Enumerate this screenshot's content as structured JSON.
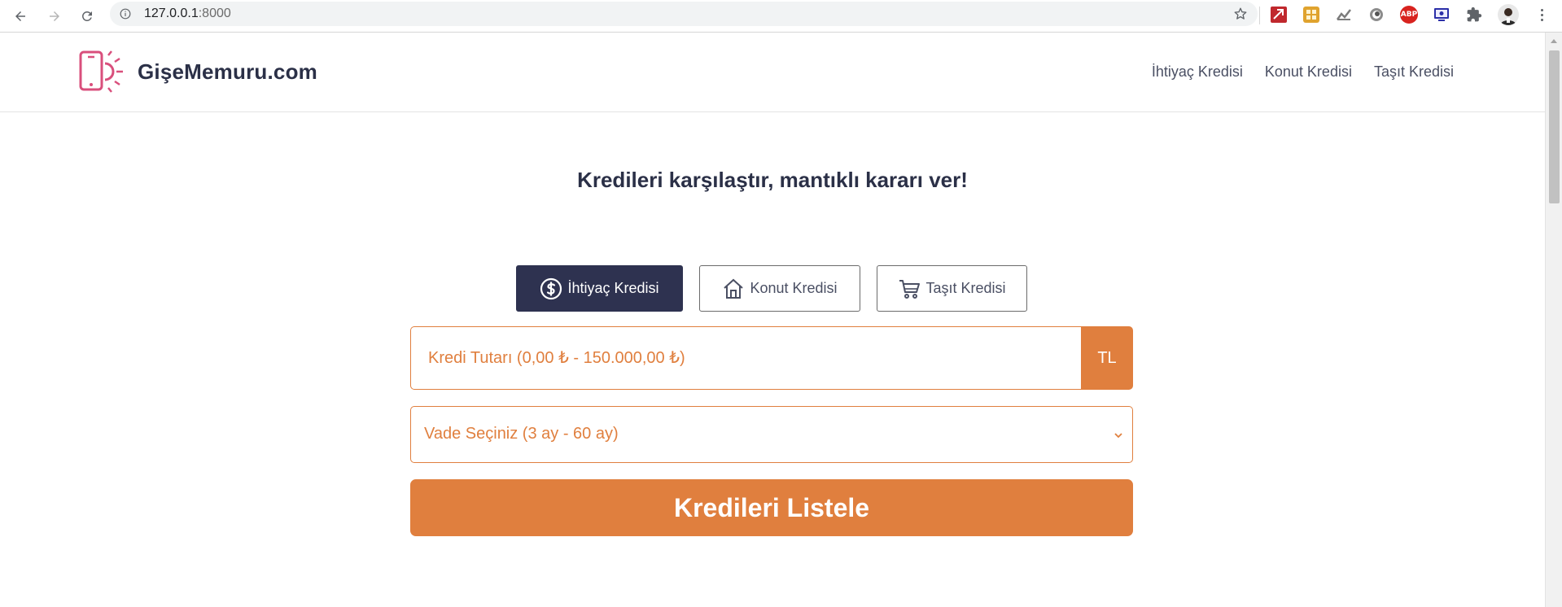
{
  "browser": {
    "url_host": "127.0.0.1",
    "url_port": ":8000",
    "icons": [
      "back-icon",
      "forward-icon",
      "reload-icon",
      "site-info-icon",
      "bookmark-star-icon",
      "extensions-puzzle-icon",
      "profile-avatar",
      "menu-dots-icon"
    ],
    "extensions": [
      {
        "name": "pdf-extension-icon",
        "label": "",
        "color": "#c0282d"
      },
      {
        "name": "grid-extension-icon",
        "label": "",
        "color": "#e0a32e"
      },
      {
        "name": "chart-extension-icon",
        "label": "",
        "color": "#7c7c7c"
      },
      {
        "name": "circle-extension-icon",
        "label": "",
        "color": "#555555"
      },
      {
        "name": "adblock-extension-icon",
        "label": "ABP",
        "color": "#d8231f"
      },
      {
        "name": "screen-extension-icon",
        "label": "",
        "color": "#2b2fa8"
      }
    ]
  },
  "header": {
    "brand": "GişeMemuru.com",
    "logo_icon": "phone-sun-icon",
    "logo_color": "#d94f7c",
    "nav": [
      {
        "label": "İhtiyaç Kredisi"
      },
      {
        "label": "Konut Kredisi"
      },
      {
        "label": "Taşıt Kredisi"
      }
    ]
  },
  "main": {
    "headline": "Kredileri karşılaştır, mantıklı kararı ver!",
    "tabs": [
      {
        "label": "İhtiyaç Kredisi",
        "icon": "dollar-circle-icon",
        "active": true
      },
      {
        "label": "Konut Kredisi",
        "icon": "house-icon",
        "active": false
      },
      {
        "label": "Taşıt Kredisi",
        "icon": "cart-icon",
        "active": false
      }
    ],
    "amount": {
      "placeholder": "Kredi Tutarı (0,00 ₺ - 150.000,00 ₺)",
      "value": "",
      "addon": "TL"
    },
    "term": {
      "selected": "Vade Seçiniz (3 ay - 60 ay)"
    },
    "submit_label": "Kredileri Listele"
  },
  "colors": {
    "accent": "#e07f3e",
    "dark": "#2e3250",
    "text": "#2b3047",
    "logo": "#d94f7c"
  }
}
